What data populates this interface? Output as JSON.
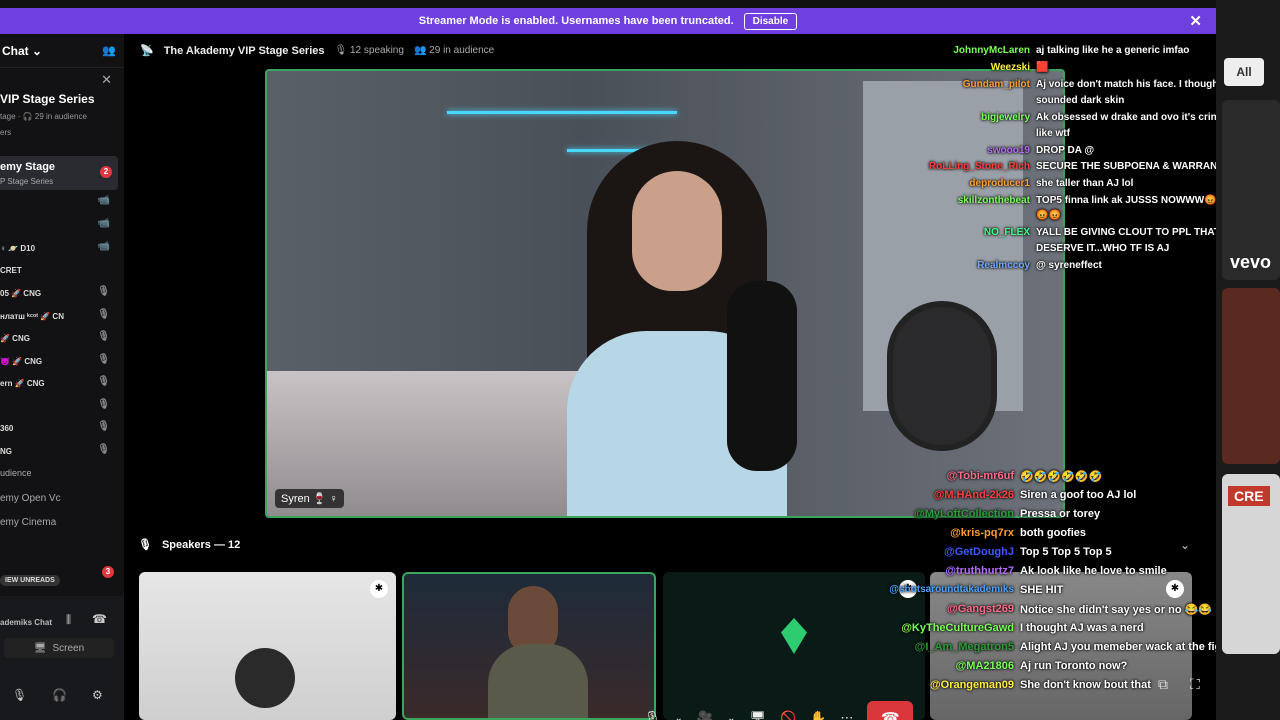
{
  "banner": {
    "text": "Streamer Mode is enabled. Usernames have been truncated.",
    "disable_label": "Disable",
    "close": "✕"
  },
  "sidebar": {
    "header": "Chat",
    "event_title": "VIP Stage Series",
    "event_sub": "tage · 🎧 29 in audience",
    "event_sub2": "ers",
    "stage_item": {
      "title": "emy Stage",
      "subtitle": "P Stage Series",
      "badge": "2"
    },
    "rows": [
      {
        "label": "",
        "icon": "📹"
      },
      {
        "label": "",
        "icon": "📹"
      },
      {
        "label": "♀ 🪐 D10",
        "icon": "📹"
      },
      {
        "label": "CRET",
        "icon": ""
      },
      {
        "label": "05 🚀 CNG",
        "icon": "🎙"
      },
      {
        "label": "нлатш ᵏᶜᵒᵗ 🚀 CN",
        "icon": "🎙"
      },
      {
        "label": "🚀 CNG",
        "icon": "🎙"
      },
      {
        "label": "😈 🚀 CNG",
        "icon": "🎙"
      },
      {
        "label": "ern 🚀 CNG",
        "icon": "🎙"
      },
      {
        "label": "",
        "icon": "🎙"
      },
      {
        "label": "360",
        "icon": "🎙"
      },
      {
        "label": "NG",
        "icon": "🎙"
      }
    ],
    "audience_label": "udience",
    "channel_open_vc": "emy Open Vc",
    "channel_cinema": "emy Cinema",
    "new_unreads": "IEW UNREADS",
    "unread_badge": "3",
    "voice_chat": "ademiks Chat",
    "screen_label": "Screen"
  },
  "stage": {
    "title": "The Akademy VIP Stage Series",
    "speaking": "12 speaking",
    "audience": "29 in audience",
    "video_name": "Syren 🍷 ♀",
    "speakers_label": "Speakers — 12"
  },
  "chat_top": [
    {
      "user": "JohnnyMcLaren",
      "color": "#7bff5a",
      "msg": "aj talking like he a generic imfao"
    },
    {
      "user": "Weezski",
      "color": "#ffee44",
      "msg": "🟥"
    },
    {
      "user": "Gundam_pilot",
      "color": "#ff9e2c",
      "msg": "Aj voice don't match his face. I thought he"
    },
    {
      "user": "",
      "color": "#fff",
      "msg": "sounded dark skin"
    },
    {
      "user": "bigjewelry",
      "color": "#7bff5a",
      "msg": "Ak obsessed w drake and ovo it's cringe atp"
    },
    {
      "user": "",
      "color": "#fff",
      "msg": "like wtf"
    },
    {
      "user": "swooo19",
      "color": "#b36bff",
      "msg": "DROP DA @"
    },
    {
      "user": "RoLLing_Stone_Rich",
      "color": "#ff3d3d",
      "msg": "SECURE THE SUBPOENA & WARRANTS"
    },
    {
      "user": "deproducer1",
      "color": "#ff9e2c",
      "msg": "she taller than AJ lol"
    },
    {
      "user": "skillzonthebeat",
      "color": "#7bff5a",
      "msg": "TOP5 finna link ak JUSSS NOWWW😡😡😡"
    },
    {
      "user": "",
      "color": "#fff",
      "msg": "😡😡"
    },
    {
      "user": "NO_FLEX",
      "color": "#3cff8a",
      "msg": "YALL BE GIVING CLOUT TO PPL THAT DONT"
    },
    {
      "user": "",
      "color": "#fff",
      "msg": "DESERVE IT...WHO TF IS AJ"
    },
    {
      "user": "Realmccoy",
      "color": "#6fa8ff",
      "msg": "@ syreneffect"
    }
  ],
  "chat_bottom": [
    {
      "user": "@Tobi-mr6uf",
      "color": "#ff6b8a",
      "msg": "🤣🤣🤣🤣🤣🤣"
    },
    {
      "user": "@M.HAnd-2k26",
      "color": "#ff3d3d",
      "msg": "Siren a goof too AJ lol"
    },
    {
      "user": "@MyLoftCollection",
      "color": "#2e9b3a",
      "msg": "Pressa or torey"
    },
    {
      "user": "@kris-pq7rx",
      "color": "#ff9e2c",
      "msg": "both goofies"
    },
    {
      "user": "@GetDoughJ",
      "color": "#3b5bff",
      "msg": "Top 5 Top 5 Top 5"
    },
    {
      "user": "@truthhurtz7",
      "color": "#b36bff",
      "msg": "Ak look like he love to smile"
    },
    {
      "user": "@shotsaroundtakademiks",
      "color": "#4da3ff",
      "msg": "SHE HIT"
    },
    {
      "user": "@Gangst269",
      "color": "#ff6b8a",
      "msg": "Notice she didn't say yes or no 😂😂"
    },
    {
      "user": "@KyTheCultureGawd",
      "color": "#7bff5a",
      "msg": "I thought AJ was a nerd"
    },
    {
      "user": "@I_Am_Megatron5",
      "color": "#2e9b3a",
      "msg": "Alight AJ you memeber wack at the fight"
    },
    {
      "user": "@MA21806",
      "color": "#7bff5a",
      "msg": "Aj run Toronto now?"
    },
    {
      "user": "@Orangeman09",
      "color": "#ffee44",
      "msg": "She don't know bout that"
    }
  ],
  "right": {
    "all_label": "All",
    "vevo": "vevo",
    "cre": "CRE"
  },
  "icons": {
    "chevron": "⌄",
    "add_member": "👥",
    "mic": "🎙",
    "headset": "🎧",
    "gear": "⚙",
    "end_call": "☎",
    "camera": "🎥",
    "share": "🖥",
    "mute_mic": "🚫",
    "more": "⋯",
    "hand": "✋",
    "pin": "✱",
    "stage": "📡"
  }
}
